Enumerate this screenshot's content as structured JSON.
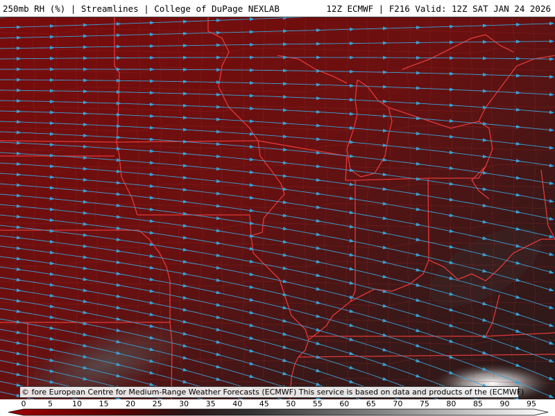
{
  "header": {
    "left": "250mb RH (%) | Streamlines | College of DuPage NEXLAB",
    "right": "12Z ECMWF | F216 Valid: 12Z SAT JAN 24 2026"
  },
  "copyright": "© fore European Centre for Medium-Range Weather Forecasts (ECMWF) This service is based on data and products of the (ECMWF)",
  "colorbar": {
    "ticks": [
      "0",
      "5",
      "10",
      "15",
      "20",
      "25",
      "30",
      "35",
      "40",
      "45",
      "50",
      "55",
      "60",
      "65",
      "70",
      "75",
      "80",
      "85",
      "90",
      "95"
    ],
    "colors": {
      "low": "#8b0000",
      "mid": "#2a1a1a",
      "high": "#ffffff"
    }
  },
  "map": {
    "background_color": "#7a0c0c",
    "border_color": "#e23a3a",
    "county_color": "#a03030",
    "streamline_color": "#3a9fd0"
  }
}
